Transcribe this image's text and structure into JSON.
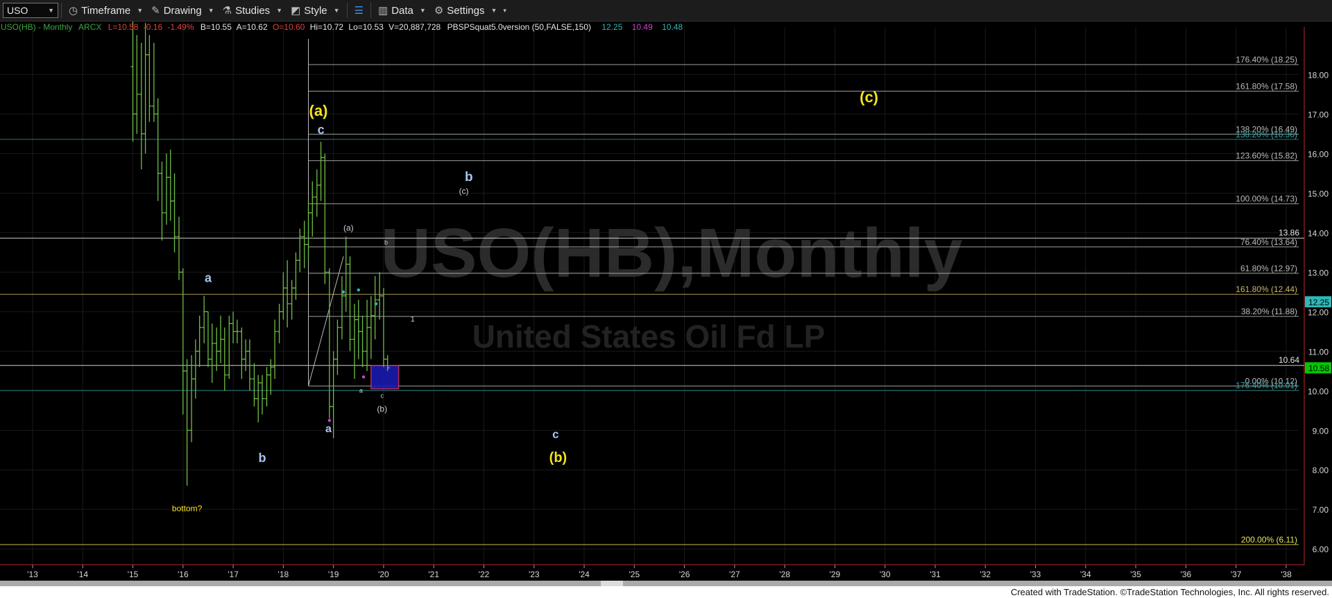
{
  "toolbar": {
    "symbol": "USO",
    "timeframe": "Timeframe",
    "drawing": "Drawing",
    "studies": "Studies",
    "style": "Style",
    "data": "Data",
    "settings": "Settings"
  },
  "header": {
    "name": "USO(HB) - Monthly",
    "exchange": "ARCX",
    "last": "L=10.58",
    "chg": "-0.16",
    "pct": "-1.49%",
    "bid": "B=10.55",
    "ask": "A=10.62",
    "open": "O=10.60",
    "high": "Hi=10.72",
    "low": "Lo=10.53",
    "vol": "V=20,887,728",
    "study": "PBSPSquat5.0version (50,FALSE,150)",
    "v1": "12.25",
    "v2": "10.49",
    "v3": "10.48"
  },
  "watermark": {
    "title": "USO(HB),Monthly",
    "subtitle": "United States Oil Fd LP"
  },
  "footer": "Created with TradeStation. ©TradeStation Technologies, Inc. All rights reserved.",
  "colors": {
    "up": "#3ea53e",
    "yellow": "#f5e21f",
    "blue": "#a9c4ef",
    "last": "#00c800",
    "bar": "#6fbf44"
  },
  "chart_data": {
    "type": "bar",
    "title": "USO(HB) - Monthly",
    "ylim": [
      5.6,
      19.2
    ],
    "y_ticks": [
      "6.00",
      "7.00",
      "8.00",
      "9.00",
      "10.00",
      "11.00",
      "12.00",
      "13.00",
      "14.00",
      "15.00",
      "16.00",
      "17.00",
      "18.00"
    ],
    "x_ticks": [
      "'13",
      "'14",
      "'15",
      "'16",
      "'17",
      "'18",
      "'19",
      "'20",
      "'21",
      "'22",
      "'23",
      "'24",
      "'25",
      "'26",
      "'27",
      "'28",
      "'29",
      "'30",
      "'31",
      "'32",
      "'33",
      "'34",
      "'35",
      "'36",
      "'37",
      "'38"
    ],
    "xlim": [
      2012.35,
      2038.25
    ],
    "ohlc": [
      [
        2015.0,
        18.2,
        19.5,
        16.3,
        17.0
      ],
      [
        2015.08,
        17.0,
        19.0,
        16.5,
        17.5
      ],
      [
        2015.17,
        17.5,
        18.8,
        15.6,
        16.5
      ],
      [
        2015.25,
        16.5,
        19.3,
        16.0,
        18.5
      ],
      [
        2015.33,
        18.5,
        19.0,
        16.8,
        17.2
      ],
      [
        2015.42,
        17.2,
        18.8,
        16.8,
        17.0
      ],
      [
        2015.5,
        17.0,
        17.4,
        14.8,
        15.5
      ],
      [
        2015.58,
        15.5,
        15.8,
        13.8,
        14.5
      ],
      [
        2015.67,
        14.5,
        16.0,
        14.2,
        15.4
      ],
      [
        2015.75,
        15.4,
        16.1,
        14.3,
        14.8
      ],
      [
        2015.83,
        14.8,
        15.5,
        13.5,
        13.9
      ],
      [
        2015.92,
        13.9,
        14.4,
        12.8,
        13.0
      ],
      [
        2016.0,
        13.0,
        13.1,
        9.4,
        10.5
      ],
      [
        2016.08,
        10.5,
        10.8,
        7.6,
        9.0
      ],
      [
        2016.17,
        9.0,
        10.9,
        8.7,
        10.3
      ],
      [
        2016.25,
        10.3,
        11.3,
        9.8,
        11.0
      ],
      [
        2016.33,
        11.0,
        11.9,
        10.6,
        11.6
      ],
      [
        2016.42,
        11.6,
        12.4,
        11.2,
        12.0
      ],
      [
        2016.5,
        12.0,
        12.0,
        10.6,
        10.8
      ],
      [
        2016.58,
        10.8,
        11.7,
        10.2,
        11.2
      ],
      [
        2016.67,
        11.2,
        11.6,
        10.5,
        11.0
      ],
      [
        2016.75,
        11.0,
        11.9,
        10.7,
        11.3
      ],
      [
        2016.83,
        11.3,
        11.6,
        10.0,
        10.4
      ],
      [
        2016.92,
        10.4,
        11.9,
        10.3,
        11.7
      ],
      [
        2017.0,
        11.7,
        12.0,
        11.2,
        11.5
      ],
      [
        2017.08,
        11.5,
        11.8,
        11.2,
        11.5
      ],
      [
        2017.17,
        11.5,
        11.6,
        10.3,
        10.8
      ],
      [
        2017.25,
        10.8,
        11.3,
        10.5,
        11.0
      ],
      [
        2017.33,
        11.0,
        11.3,
        10.0,
        10.3
      ],
      [
        2017.42,
        10.3,
        10.7,
        9.6,
        9.8
      ],
      [
        2017.5,
        9.8,
        10.4,
        9.2,
        10.2
      ],
      [
        2017.58,
        10.2,
        10.4,
        9.4,
        9.8
      ],
      [
        2017.67,
        9.8,
        10.6,
        9.6,
        10.4
      ],
      [
        2017.75,
        10.4,
        10.8,
        9.9,
        10.6
      ],
      [
        2017.83,
        10.6,
        11.8,
        10.3,
        11.5
      ],
      [
        2017.92,
        11.5,
        12.2,
        11.2,
        12.0
      ],
      [
        2018.0,
        12.0,
        13.0,
        11.8,
        12.6
      ],
      [
        2018.08,
        12.6,
        13.3,
        11.6,
        12.2
      ],
      [
        2018.17,
        12.2,
        12.8,
        11.8,
        12.6
      ],
      [
        2018.25,
        12.6,
        13.5,
        12.3,
        13.3
      ],
      [
        2018.33,
        13.3,
        14.1,
        13.0,
        13.9
      ],
      [
        2018.42,
        13.9,
        14.3,
        13.1,
        13.7
      ],
      [
        2018.5,
        13.7,
        14.8,
        13.3,
        14.5
      ],
      [
        2018.58,
        14.5,
        15.3,
        13.9,
        14.9
      ],
      [
        2018.67,
        14.9,
        15.6,
        14.4,
        15.2
      ],
      [
        2018.75,
        15.2,
        16.3,
        14.8,
        15.9
      ],
      [
        2018.83,
        15.9,
        16.0,
        12.7,
        13.0
      ],
      [
        2018.92,
        13.0,
        13.1,
        9.3,
        9.6
      ],
      [
        2019.0,
        9.6,
        11.0,
        8.8,
        10.8
      ],
      [
        2019.08,
        10.8,
        11.8,
        10.4,
        11.6
      ],
      [
        2019.17,
        11.6,
        12.9,
        11.3,
        12.4
      ],
      [
        2019.25,
        12.4,
        13.9,
        12.0,
        13.2
      ],
      [
        2019.33,
        13.2,
        13.4,
        11.0,
        11.3
      ],
      [
        2019.42,
        11.3,
        12.2,
        10.3,
        11.8
      ],
      [
        2019.5,
        11.8,
        12.3,
        10.8,
        11.5
      ],
      [
        2019.58,
        11.5,
        11.9,
        10.6,
        11.0
      ],
      [
        2019.67,
        11.0,
        12.3,
        10.5,
        11.6
      ],
      [
        2019.75,
        11.6,
        12.4,
        10.8,
        11.9
      ],
      [
        2019.83,
        11.9,
        12.9,
        11.3,
        12.3
      ],
      [
        2019.92,
        12.3,
        13.0,
        11.8,
        12.4
      ],
      [
        2020.0,
        12.4,
        12.6,
        10.6,
        10.8
      ],
      [
        2020.08,
        10.8,
        10.9,
        10.5,
        10.58
      ]
    ],
    "fib_levels": [
      {
        "label": "176.40% (18.25)",
        "y": 18.25,
        "color": "#bbbbbb"
      },
      {
        "label": "161.80% (17.58)",
        "y": 17.58,
        "color": "#bbbbbb"
      },
      {
        "label": "138.20% (16.49)",
        "y": 16.49,
        "color": "#bbbbbb"
      },
      {
        "label": "138.20% (16.36)",
        "y": 16.36,
        "color": "#2a8f93"
      },
      {
        "label": "123.60% (15.82)",
        "y": 15.82,
        "color": "#bbbbbb"
      },
      {
        "label": "100.00% (14.73)",
        "y": 14.73,
        "color": "#bbbbbb"
      },
      {
        "label": "76.40% (13.64)",
        "y": 13.64,
        "color": "#bbbbbb"
      },
      {
        "label": "61.80% (12.97)",
        "y": 12.97,
        "color": "#bbbbbb"
      },
      {
        "label": "161.80% (12.44)",
        "y": 12.44,
        "color": "#c9b86b"
      },
      {
        "label": "38.20% (11.88)",
        "y": 11.88,
        "color": "#bbbbbb"
      },
      {
        "label": "0.00% (10.12)",
        "y": 10.12,
        "color": "#bbbbbb"
      },
      {
        "label": "176.40% (10.01)",
        "y": 10.01,
        "color": "#2a8f93"
      },
      {
        "label": "200.00% (6.11)",
        "y": 6.11,
        "color": "#e8e85a"
      }
    ],
    "price_lines": [
      {
        "label": "13.86",
        "y": 13.86,
        "color": "#cfcfcf"
      },
      {
        "label": "10.64",
        "y": 10.64,
        "color": "#cfcfcf"
      }
    ],
    "axis_markers": [
      {
        "label": "12.25",
        "y": 12.25,
        "bg": "#2bb8b8",
        "fg": "#000"
      },
      {
        "label": "10.58",
        "y": 10.58,
        "bg": "#00c800",
        "fg": "#000"
      }
    ],
    "wave_labels": [
      {
        "text": "(a)",
        "x": 2018.7,
        "y": 16.95,
        "color": "#f5e21f",
        "size": 22
      },
      {
        "text": "c",
        "x": 2018.75,
        "y": 16.5,
        "color": "#a9c4ef",
        "size": 18
      },
      {
        "text": "a",
        "x": 2016.5,
        "y": 12.75,
        "color": "#a9c4ef",
        "size": 18
      },
      {
        "text": "b",
        "x": 2017.58,
        "y": 8.2,
        "color": "#a9c4ef",
        "size": 18
      },
      {
        "text": "bottom?",
        "x": 2016.08,
        "y": 6.95,
        "color": "#f5e21f",
        "size": 12
      },
      {
        "text": "a",
        "x": 2018.9,
        "y": 8.95,
        "color": "#a9c4ef",
        "size": 16
      },
      {
        "text": "(a)",
        "x": 2019.3,
        "y": 14.05,
        "color": "#cfcfcf",
        "size": 12
      },
      {
        "text": "b",
        "x": 2020.05,
        "y": 13.7,
        "color": "#cfcfcf",
        "size": 9
      },
      {
        "text": "1",
        "x": 2020.58,
        "y": 11.75,
        "color": "#cfcfcf",
        "size": 11
      },
      {
        "text": "a",
        "x": 2019.55,
        "y": 9.95,
        "color": "#cfcfcf",
        "size": 9
      },
      {
        "text": "c",
        "x": 2019.97,
        "y": 9.82,
        "color": "#cfcfcf",
        "size": 9
      },
      {
        "text": "(b)",
        "x": 2019.97,
        "y": 9.47,
        "color": "#cfcfcf",
        "size": 12
      },
      {
        "text": "b",
        "x": 2021.7,
        "y": 15.3,
        "color": "#a9c4ef",
        "size": 19
      },
      {
        "text": "(c)",
        "x": 2021.6,
        "y": 14.98,
        "color": "#cfcfcf",
        "size": 12
      },
      {
        "text": "c",
        "x": 2023.43,
        "y": 8.8,
        "color": "#a9c4ef",
        "size": 17
      },
      {
        "text": "(b)",
        "x": 2023.48,
        "y": 8.2,
        "color": "#f5e21f",
        "size": 20
      },
      {
        "text": "(c)",
        "x": 2029.68,
        "y": 17.3,
        "color": "#f5e21f",
        "size": 22
      }
    ],
    "box": {
      "x0": 2019.75,
      "x1": 2020.3,
      "y0": 10.05,
      "y1": 10.64
    },
    "dots": [
      {
        "x": 2019.2,
        "y": 12.5,
        "color": "#2bb8b8"
      },
      {
        "x": 2019.5,
        "y": 12.55,
        "color": "#2bb8b8"
      },
      {
        "x": 2019.85,
        "y": 12.2,
        "color": "#2bb8b8"
      },
      {
        "x": 2019.6,
        "y": 10.35,
        "color": "#d040d0"
      },
      {
        "x": 2018.92,
        "y": 9.25,
        "color": "#d040d0"
      }
    ],
    "tool_lines": [
      {
        "x1": 2018.5,
        "y1": 10.12,
        "x2": 2019.2,
        "y2": 13.4,
        "color": "#bbbbbb"
      },
      {
        "x1": 2018.5,
        "y1": 10.12,
        "x2": 2018.5,
        "y2": 18.9,
        "color": "#bbbbbb"
      }
    ]
  }
}
